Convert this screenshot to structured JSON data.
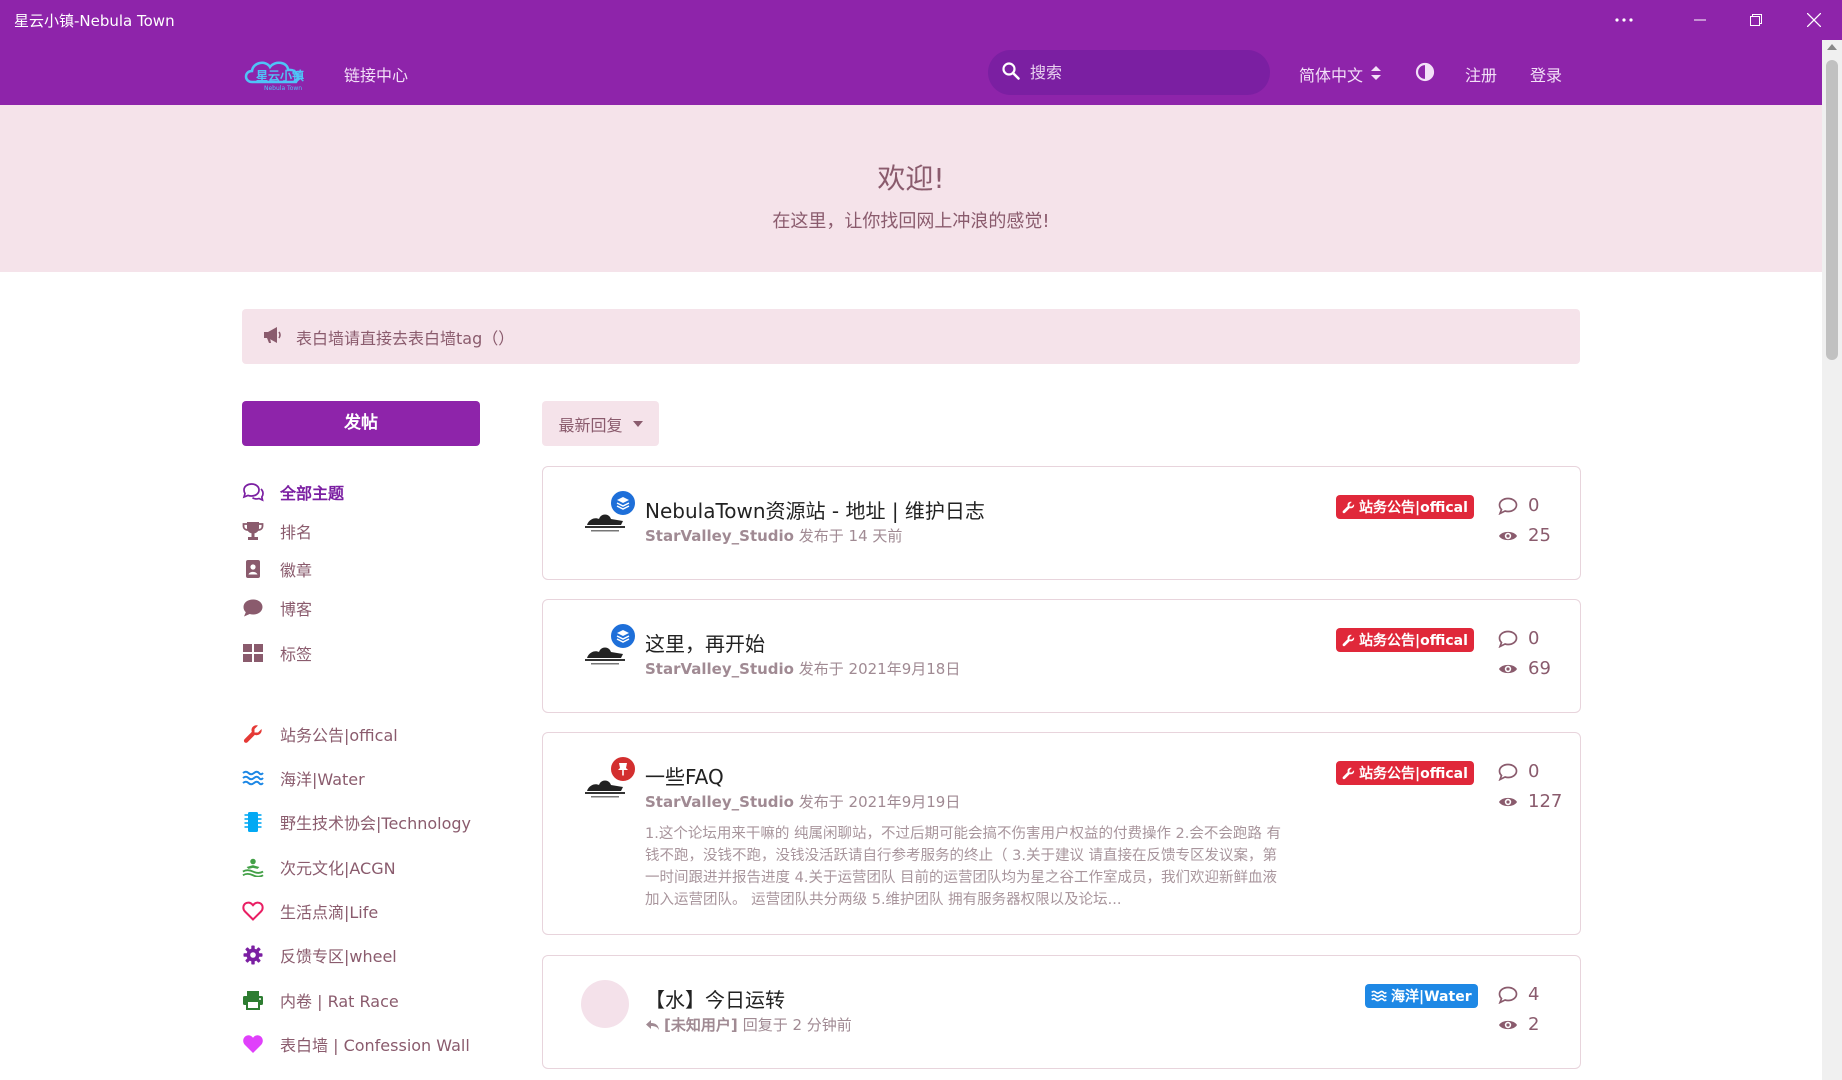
{
  "window": {
    "title": "星云小镇-Nebula Town"
  },
  "navbar": {
    "logo_text": "星云小镇",
    "logo_subtext": "Nebula Town",
    "links_label": "链接中心",
    "search_placeholder": "搜索",
    "language": "简体中文",
    "register": "注册",
    "login": "登录"
  },
  "hero": {
    "title": "欢迎!",
    "subtitle": "在这里，让你找回网上冲浪的感觉!"
  },
  "announcement": {
    "text": "表白墙请直接去表白墙tag（）"
  },
  "sidebar": {
    "post_button": "发帖",
    "nav": [
      {
        "label": "全部主题",
        "icon": "comments-icon"
      },
      {
        "label": "排名",
        "icon": "trophy-icon"
      },
      {
        "label": "徽章",
        "icon": "badge-icon"
      },
      {
        "label": "博客",
        "icon": "comment-icon"
      },
      {
        "label": "标签",
        "icon": "tags-grid-icon"
      }
    ],
    "tags": [
      {
        "label": "站务公告|offical",
        "icon": "wrench-icon",
        "color": "#e53935"
      },
      {
        "label": "海洋|Water",
        "icon": "water-icon",
        "color": "#1e88e5"
      },
      {
        "label": "野生技术协会|Technology",
        "icon": "chip-icon",
        "color": "#03a9f4"
      },
      {
        "label": "次元文化|ACGN",
        "icon": "acgn-icon",
        "color": "#43a047"
      },
      {
        "label": "生活点滴|Life",
        "icon": "heart-outline-icon",
        "color": "#e91e63"
      },
      {
        "label": "反馈专区|wheel",
        "icon": "gear-icon",
        "color": "#7b1fa2"
      },
      {
        "label": "内卷 | Rat Race",
        "icon": "printer-icon",
        "color": "#2e7d32"
      },
      {
        "label": "表白墙 | Confession Wall",
        "icon": "heart-icon",
        "color": "#e040fb"
      }
    ]
  },
  "sort": {
    "label": "最新回复"
  },
  "discussions": [
    {
      "title": "NebulaTown资源站 - 地址 | 维护日志",
      "author": "StarValley_Studio",
      "meta": "发布于 14 天前",
      "tag": "站务公告|offical",
      "tag_color": "#e0283a",
      "replies": "0",
      "views": "25",
      "badge_color": "#1e6fd9",
      "badge_icon": "layers-icon"
    },
    {
      "title": "这里，再开始",
      "author": "StarValley_Studio",
      "meta": "发布于 2021年9月18日",
      "tag": "站务公告|offical",
      "tag_color": "#e0283a",
      "replies": "0",
      "views": "69",
      "badge_color": "#1e6fd9",
      "badge_icon": "layers-icon"
    },
    {
      "title": "一些FAQ",
      "author": "StarValley_Studio",
      "meta": "发布于 2021年9月19日",
      "excerpt": "1.这个论坛用来干嘛的 纯属闲聊站，不过后期可能会搞不伤害用户权益的付费操作 2.会不会跑路 有钱不跑，没钱不跑，没钱没活跃请自行参考服务的终止（ 3.关于建议 请直接在反馈专区发议案，第一时间跟进并报告进度 4.关于运营团队 目前的运营团队均为星之谷工作室成员，我们欢迎新鲜血液加入运营团队。 运营团队共分两级 5.维护团队 拥有服务器权限以及论坛...",
      "tag": "站务公告|offical",
      "tag_color": "#e0283a",
      "replies": "0",
      "views": "127",
      "badge_color": "#d32f2f",
      "badge_icon": "pin-icon"
    },
    {
      "title": "【水】今日运转",
      "author": "[未知用户]",
      "meta": "回复于 2 分钟前",
      "tag": "海洋|Water",
      "tag_color": "#1e88e5",
      "replies": "4",
      "views": "2"
    }
  ]
}
